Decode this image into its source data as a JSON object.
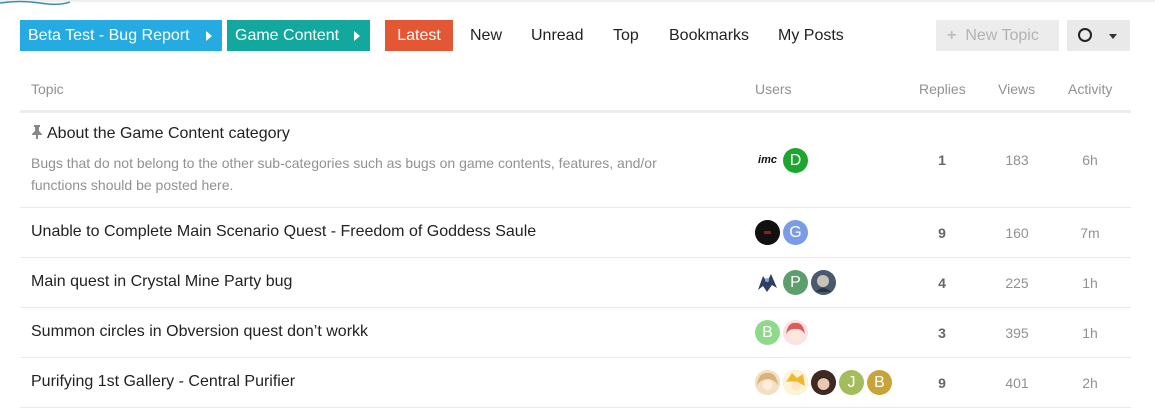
{
  "breadcrumb": [
    {
      "label": "Beta Test - Bug Report",
      "color": "#25aae1"
    },
    {
      "label": "Game Content",
      "color": "#12a89d"
    }
  ],
  "nav": {
    "tabs": [
      {
        "label": "Latest",
        "active": true
      },
      {
        "label": "New"
      },
      {
        "label": "Unread"
      },
      {
        "label": "Top"
      },
      {
        "label": "Bookmarks"
      },
      {
        "label": "My Posts"
      }
    ],
    "new_topic_label": "New Topic",
    "accent": "#e45735"
  },
  "table": {
    "headers": {
      "topic": "Topic",
      "users": "Users",
      "replies": "Replies",
      "views": "Views",
      "activity": "Activity"
    },
    "rows": [
      {
        "title": "About the Game Content category",
        "pinned": true,
        "excerpt": "Bugs that do not belong to the other sub-categories such as bugs on game contents, features, and/or functions should be posted here.",
        "users": [
          {
            "letter": "imc",
            "color": "#ffffff",
            "icon": "imc-logo"
          },
          {
            "letter": "D",
            "color": "#1da62f"
          }
        ],
        "replies": "1",
        "views": "183",
        "activity": "6h"
      },
      {
        "title": "Unable to Complete Main Scenario Quest - Freedom of Goddess Saule",
        "users": [
          {
            "letter": "",
            "color": "#111111",
            "icon": "dark-avatar"
          },
          {
            "letter": "G",
            "color": "#7a9be6"
          }
        ],
        "replies": "9",
        "views": "160",
        "activity": "7m"
      },
      {
        "title": "Main quest in Crystal Mine Party bug",
        "users": [
          {
            "letter": "",
            "color": "#3b4a6b",
            "icon": "character-avatar"
          },
          {
            "letter": "P",
            "color": "#5c9e6c"
          },
          {
            "letter": "",
            "color": "#556677",
            "icon": "character-avatar"
          }
        ],
        "replies": "4",
        "views": "225",
        "activity": "1h"
      },
      {
        "title": "Summon circles in Obversion quest don’t workk",
        "users": [
          {
            "letter": "B",
            "color": "#8fd98a"
          },
          {
            "letter": "",
            "color": "#f2a4a4",
            "icon": "character-avatar"
          }
        ],
        "replies": "3",
        "views": "395",
        "activity": "1h"
      },
      {
        "title": "Purifying 1st Gallery - Central Purifier",
        "users": [
          {
            "letter": "",
            "color": "#e8c9a0",
            "icon": "character-avatar"
          },
          {
            "letter": "",
            "color": "#f2c14e",
            "icon": "character-avatar"
          },
          {
            "letter": "",
            "color": "#5a3a2e",
            "icon": "character-avatar"
          },
          {
            "letter": "J",
            "color": "#a3bd5c"
          },
          {
            "letter": "B",
            "color": "#c7a33a"
          }
        ],
        "replies": "9",
        "views": "401",
        "activity": "2h"
      }
    ]
  }
}
